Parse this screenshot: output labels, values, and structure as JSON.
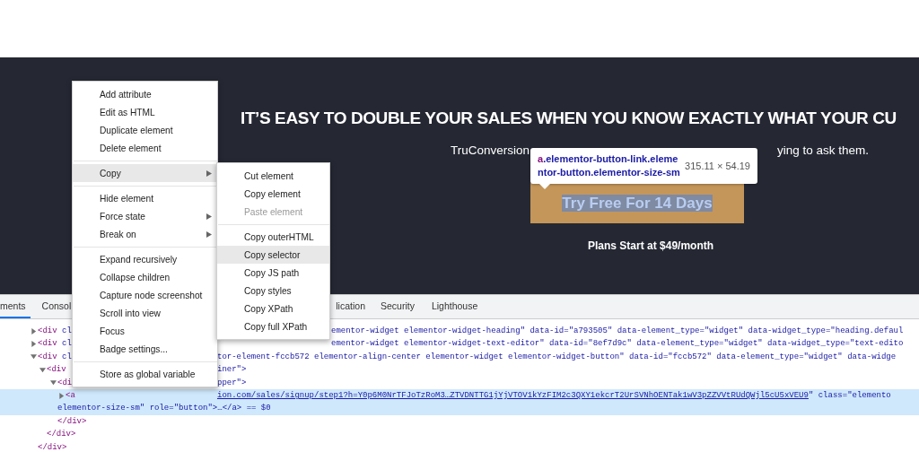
{
  "hero": {
    "heading": "IT’S EASY TO DOUBLE YOUR SALES WHEN YOU KNOW EXACTLY WHAT YOUR CU",
    "subtitle_start": "TruConversion",
    "subtitle_end": "ying to ask them.",
    "button": "Try Free For 14 Days",
    "plans": "Plans Start at $49/month"
  },
  "tooltip": {
    "tag": "a",
    "selector_line_1": ".elementor-button-link.eleme",
    "selector_line_2": "ntor-button.elementor-size-sm",
    "size": "315.11 × 54.19"
  },
  "devtools": {
    "tabs": [
      {
        "label": "ments",
        "selected": true
      },
      {
        "label": "Consol",
        "selected": false
      },
      {
        "label": "lication",
        "selected": false
      },
      {
        "label": "Security",
        "selected": false
      },
      {
        "label": "Lighthouse",
        "selected": false
      }
    ],
    "code_lines": [
      {
        "expanded": false,
        "left": "<div cl",
        "right": "ementor-widget elementor-widget-heading\" data-id=\"a793505\" data-element_type=\"widget\" data-widget_type=\"heading.defaul",
        "selected": false
      },
      {
        "expanded": false,
        "left": "<div cl",
        "right": "ementor-widget elementor-widget-text-editor\" data-id=\"8ef7d9c\" data-element_type=\"widget\" data-widget_type=\"text-edito",
        "selected": false
      },
      {
        "expanded": true,
        "left": "<div cl",
        "right": "tor-element-fccb572 elementor-align-center elementor-widget elementor-widget-button\" data-id=\"fccb572\" data-element_type=\"widget\" data-widge",
        "selected": false
      },
      {
        "expanded": true,
        "left": "<div",
        "right": "iner\">",
        "selected": false
      },
      {
        "expanded": true,
        "left": "<di",
        "right": "pper\">",
        "selected": false
      },
      {
        "expanded": false,
        "left": "<a",
        "right": "ion.com/sales/signup/step1?h=Y0p6M0NrTFJoTzRoM3…ZTVDNTTG1jYjVTOV1kYzFIM2c3QXY1ekcrT2UrSVNhOENTak1wV3pZZVVtRUdQWjl5cU5xVEU9\" class=\"elemento",
        "selected": true
      },
      {
        "left": "elementor-size-sm\" role=\"button\">…</a> == $0",
        "selected": true
      },
      {
        "left": "</div>",
        "selected": false
      },
      {
        "left": "</div>",
        "selected": false
      },
      {
        "left": "</div>",
        "selected": false
      }
    ]
  },
  "context_menu": {
    "groups": [
      [
        {
          "label": "Add attribute",
          "highlighted": false,
          "has_submenu": false
        },
        {
          "label": "Edit as HTML",
          "highlighted": false,
          "has_submenu": false
        },
        {
          "label": "Duplicate element",
          "highlighted": false,
          "has_submenu": false
        },
        {
          "label": "Delete element",
          "highlighted": false,
          "has_submenu": false
        }
      ],
      [
        {
          "label": "Copy",
          "highlighted": true,
          "has_submenu": true
        }
      ],
      [
        {
          "label": "Hide element",
          "highlighted": false,
          "has_submenu": false
        },
        {
          "label": "Force state",
          "highlighted": false,
          "has_submenu": true
        },
        {
          "label": "Break on",
          "highlighted": false,
          "has_submenu": true
        }
      ],
      [
        {
          "label": "Expand recursively",
          "highlighted": false,
          "has_submenu": false
        },
        {
          "label": "Collapse children",
          "highlighted": false,
          "has_submenu": false
        },
        {
          "label": "Capture node screenshot",
          "highlighted": false,
          "has_submenu": false
        },
        {
          "label": "Scroll into view",
          "highlighted": false,
          "has_submenu": false
        },
        {
          "label": "Focus",
          "highlighted": false,
          "has_submenu": false
        },
        {
          "label": "Badge settings...",
          "highlighted": false,
          "has_submenu": false
        }
      ],
      [
        {
          "label": "Store as global variable",
          "highlighted": false,
          "has_submenu": false
        }
      ]
    ]
  },
  "copy_submenu": {
    "groups": [
      [
        {
          "label": "Cut element",
          "highlighted": false,
          "disabled": false
        },
        {
          "label": "Copy element",
          "highlighted": false,
          "disabled": false
        },
        {
          "label": "Paste element",
          "highlighted": false,
          "disabled": true
        }
      ],
      [
        {
          "label": "Copy outerHTML",
          "highlighted": false,
          "disabled": false
        },
        {
          "label": "Copy selector",
          "highlighted": true,
          "disabled": false
        },
        {
          "label": "Copy JS path",
          "highlighted": false,
          "disabled": false
        },
        {
          "label": "Copy styles",
          "highlighted": false,
          "disabled": false
        },
        {
          "label": "Copy XPath",
          "highlighted": false,
          "disabled": false
        },
        {
          "label": "Copy full XPath",
          "highlighted": false,
          "disabled": false
        }
      ]
    ]
  }
}
